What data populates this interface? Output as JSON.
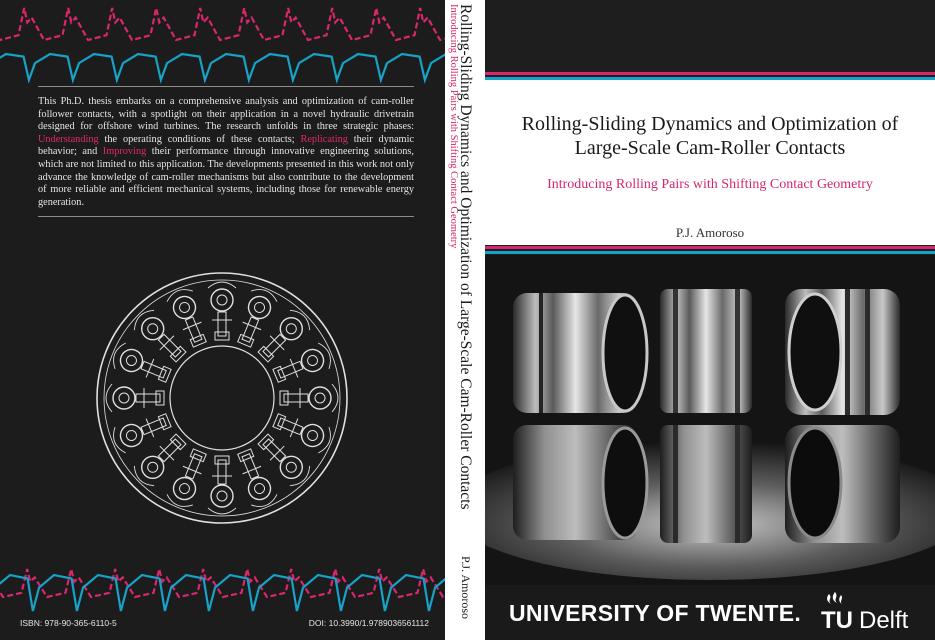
{
  "colors": {
    "background": "#1c1c1c",
    "accent_pink": "#d9266d",
    "accent_blue": "#17a3c9",
    "title_panel": "#ffffff"
  },
  "back_cover": {
    "abstract": {
      "p1": "This Ph.D. thesis embarks on a comprehensive analysis and optimization of cam-roller follower contacts, with a spotlight on their application in a novel hydraulic drivetrain designed for offshore wind turbines.  The research unfolds in three strategic phases: ",
      "h1": "Understanding",
      "p2": " the operating conditions of these contacts; ",
      "h2": "Replicating",
      "p3": " their dynamic behavior; and ",
      "h3": "Improving",
      "p4": " their performance through innovative engineering solutions, which are not limited to this application.  The developments presented in this work not only advance the knowledge of cam-roller mechanisms but also contribute to the development of more reliable and efficient mechanical systems, including those for renewable energy generation."
    },
    "isbn": "ISBN: 978-90-365-6110-5",
    "doi": "DOI: 10.3990/1.9789036561112"
  },
  "spine": {
    "title": "Rolling-Sliding Dynamics and Optimization of Large-Scale Cam-Roller Contacts",
    "subtitle": "Introducing Rolling Pairs with Shifting Contact Geometry",
    "author": "P.J. Amoroso"
  },
  "front_cover": {
    "title_line1": "Rolling-Sliding Dynamics and Optimization of",
    "title_line2": "Large-Scale Cam-Roller Contacts",
    "subtitle": "Introducing Rolling Pairs with Shifting Contact Geometry",
    "author": "P.J. Amoroso",
    "logo_twente": "UNIVERSITY OF TWENTE.",
    "logo_tudelft_left": "TU",
    "logo_tudelft_right": "Delft"
  }
}
